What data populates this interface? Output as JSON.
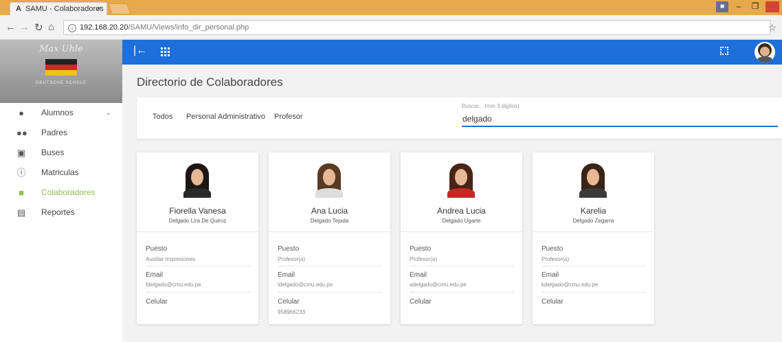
{
  "browser": {
    "tab_icon": "A",
    "tab_title": "SAMU - Colaboradores",
    "tab_close": "×",
    "url_host": "192.168.20.20",
    "url_path": "/SAMU/Views/info_dir_personal.php"
  },
  "sidebar": {
    "logo_text": "Max Uhle",
    "logo_sub": "DEUTSCHE SCHULE",
    "items": [
      {
        "label": "Alumnos",
        "icon": "person-icon"
      },
      {
        "label": "Padres",
        "icon": "people-icon"
      },
      {
        "label": "Buses",
        "icon": "bus-icon"
      },
      {
        "label": "Matriculas",
        "icon": "info-icon"
      },
      {
        "label": "Colaboradores",
        "icon": "briefcase-icon",
        "active": true
      },
      {
        "label": "Reportes",
        "icon": "clipboard-icon"
      }
    ]
  },
  "page": {
    "title": "Directorio de Colaboradores",
    "filters": [
      "Todos",
      "Personal Administrativo",
      "Profesor"
    ],
    "search_label": "Buscar... (min 3 digitos)",
    "search_value": "delgado"
  },
  "cards": [
    {
      "first_name": "Fiorella Vanesa",
      "surnames": "Delgado Lira De Quiroz",
      "puesto_label": "Puesto",
      "puesto": "Auxiliar Impresiones",
      "email_label": "Email",
      "email": "fdelgado@cmu.edu.pe",
      "celular_label": "Celular",
      "celular": ""
    },
    {
      "first_name": "Ana Lucia",
      "surnames": "Delgado Tejada",
      "puesto_label": "Puesto",
      "puesto": "Profesor(a)",
      "email_label": "Email",
      "email": "ldelgado@cmu.edu.pe",
      "celular_label": "Celular",
      "celular": "958966233"
    },
    {
      "first_name": "Andrea Lucia",
      "surnames": "Delgado Ugarte",
      "puesto_label": "Puesto",
      "puesto": "Profesor(a)",
      "email_label": "Email",
      "email": "adelgado@cmu.edu.pe",
      "celular_label": "Celular",
      "celular": ""
    },
    {
      "first_name": "Karelia",
      "surnames": "Delgado Zegarra",
      "puesto_label": "Puesto",
      "puesto": "Profesor(a)",
      "email_label": "Email",
      "email": "kdelgado@cmu.edu.pe",
      "celular_label": "Celular",
      "celular": ""
    }
  ],
  "colors": {
    "app_bar": "#1e6fd9",
    "active_menu": "#8bc34a",
    "browser_frame": "#e8a94a"
  }
}
